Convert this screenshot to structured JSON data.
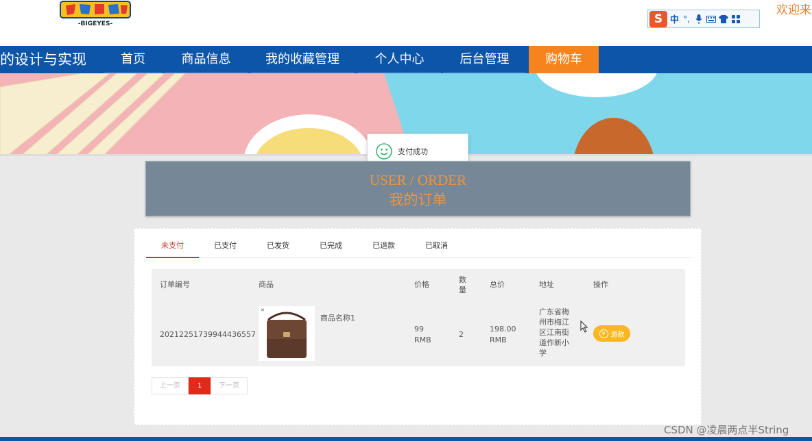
{
  "header": {
    "logo_text": "-BIGEYES-",
    "welcome": "欢迎来",
    "ime": {
      "logo": "S",
      "lang": "中"
    }
  },
  "nav": {
    "site_title": "的设计与实现",
    "items": [
      {
        "label": "首页"
      },
      {
        "label": "商品信息"
      },
      {
        "label": "我的收藏管理"
      },
      {
        "label": "个人中心"
      },
      {
        "label": "后台管理"
      },
      {
        "label": "购物车",
        "active": true
      }
    ]
  },
  "toast": {
    "text": "支付成功"
  },
  "title_panel": {
    "en": "USER / ORDER",
    "zh": "我的订单"
  },
  "tabs": [
    {
      "label": "未支付",
      "active": true
    },
    {
      "label": "已支付"
    },
    {
      "label": "已发货"
    },
    {
      "label": "已完成"
    },
    {
      "label": "已退款"
    },
    {
      "label": "已取消"
    }
  ],
  "table": {
    "headers": {
      "order_no": "订单编号",
      "product": "商品",
      "price": "价格",
      "qty_line1": "数",
      "qty_line2": "量",
      "total": "总价",
      "address": "地址",
      "action": "操作"
    },
    "rows": [
      {
        "order_no": "20212251739944436557",
        "product_name": "商品名称1",
        "price_value": "99",
        "price_unit": "RMB",
        "qty": "2",
        "total_value": "198.00",
        "total_unit": "RMB",
        "address_lines": [
          "广东省梅",
          "州市梅江",
          "区江南街",
          "道作新小",
          "学"
        ],
        "action": "退款"
      }
    ]
  },
  "pager": {
    "prev": "上一页",
    "current": "1",
    "next": "下一页"
  },
  "watermark": "CSDN @凌晨两点半String",
  "colors": {
    "nav": "#0c55a8",
    "active_nav": "#f5841f",
    "tab_active": "#c0392b",
    "refund": "#f9b721",
    "page_current": "#e02b1b"
  }
}
